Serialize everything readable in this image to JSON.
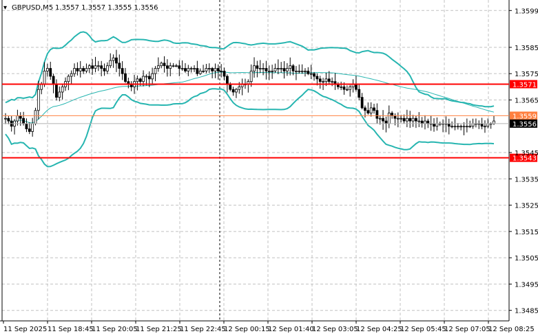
{
  "title": {
    "symbol": "GBPUSD,M5",
    "ohlc": "1.3557 1.3557 1.3555 1.3556"
  },
  "colors": {
    "background": "#ffffff",
    "grid": "#c0c0c0",
    "candle": "#000000",
    "bollinger": "#26b5b0",
    "ma": "#26b5b0",
    "level_line": "#ff0000",
    "resistance_line": "#ff7f3f",
    "price_label_bg": "#000000",
    "level_label_bg": "#ff0000",
    "resistance_label_bg": "#ff7f3f"
  },
  "chart_data": {
    "type": "candlestick",
    "ylim": [
      1.3481,
      1.3603
    ],
    "y_ticks": [
      "1.3599",
      "1.3585",
      "1.3575",
      "1.3565",
      "1.3545",
      "1.3535",
      "1.3525",
      "1.3515",
      "1.3505",
      "1.3495",
      "1.3485"
    ],
    "x_ticks": [
      "11 Sep 2025",
      "11 Sep 18:45",
      "11 Sep 20:05",
      "11 Sep 21:25",
      "11 Sep 22:45",
      "12 Sep 00:15",
      "12 Sep 01:40",
      "12 Sep 03:05",
      "12 Sep 04:25",
      "12 Sep 05:45",
      "12 Sep 07:05",
      "12 Sep 08:25"
    ],
    "price_levels": [
      {
        "name": "level-top",
        "value": 1.3571,
        "label": "1.3571",
        "style": "red-thick"
      },
      {
        "name": "level-mid",
        "value": 1.3559,
        "label": "1.3559",
        "style": "orange-thin"
      },
      {
        "name": "level-bottom",
        "value": 1.3543,
        "label": "1.3543",
        "style": "red-thick"
      }
    ],
    "current_price": {
      "value": 1.3556,
      "label": "1.3556"
    },
    "closes": [
      1.3558,
      1.3557,
      1.3555,
      1.3557,
      1.3559,
      1.3558,
      1.3556,
      1.3554,
      1.3553,
      1.3556,
      1.3561,
      1.3569,
      1.3571,
      1.3576,
      1.3577,
      1.3574,
      1.3571,
      1.3566,
      1.3568,
      1.357,
      1.3572,
      1.3574,
      1.3575,
      1.3577,
      1.3576,
      1.3577,
      1.3576,
      1.3577,
      1.3578,
      1.3577,
      1.3578,
      1.3578,
      1.3577,
      1.3576,
      1.3578,
      1.358,
      1.3581,
      1.3579,
      1.3577,
      1.3575,
      1.3572,
      1.3571,
      1.357,
      1.3572,
      1.3573,
      1.3572,
      1.3574,
      1.3574,
      1.3573,
      1.3575,
      1.3577,
      1.3578,
      1.3579,
      1.3578,
      1.3577,
      1.3578,
      1.3578,
      1.3578,
      1.3577,
      1.3577,
      1.3576,
      1.3577,
      1.3577,
      1.3577,
      1.3575,
      1.3576,
      1.3576,
      1.3577,
      1.3577,
      1.3576,
      1.3577,
      1.3576,
      1.3576,
      1.3574,
      1.3571,
      1.3569,
      1.3568,
      1.3569,
      1.357,
      1.3571,
      1.3571,
      1.3572,
      1.3576,
      1.3578,
      1.3577,
      1.3577,
      1.3577,
      1.3576,
      1.3576,
      1.3576,
      1.3577,
      1.3577,
      1.3577,
      1.3576,
      1.3577,
      1.3578,
      1.3576,
      1.3576,
      1.3576,
      1.3576,
      1.3576,
      1.3575,
      1.3575,
      1.3574,
      1.3573,
      1.3572,
      1.3572,
      1.3573,
      1.3572,
      1.3572,
      1.3571,
      1.357,
      1.357,
      1.3569,
      1.3569,
      1.357,
      1.3571,
      1.3569,
      1.3566,
      1.3562,
      1.3561,
      1.356,
      1.3562,
      1.3561,
      1.3558,
      1.3558,
      1.3557,
      1.3556,
      1.356,
      1.3559,
      1.3558,
      1.3558,
      1.3558,
      1.3557,
      1.3558,
      1.3557,
      1.3558,
      1.3557,
      1.3557,
      1.3556,
      1.3557,
      1.3556,
      1.3556,
      1.3555,
      1.3556,
      1.3556,
      1.3556,
      1.3556,
      1.3555,
      1.3555,
      1.3555,
      1.3555,
      1.3555,
      1.3555,
      1.3555,
      1.3555,
      1.3556,
      1.3556,
      1.3556,
      1.3555,
      1.3555,
      1.3556,
      1.3556,
      1.3557
    ]
  }
}
